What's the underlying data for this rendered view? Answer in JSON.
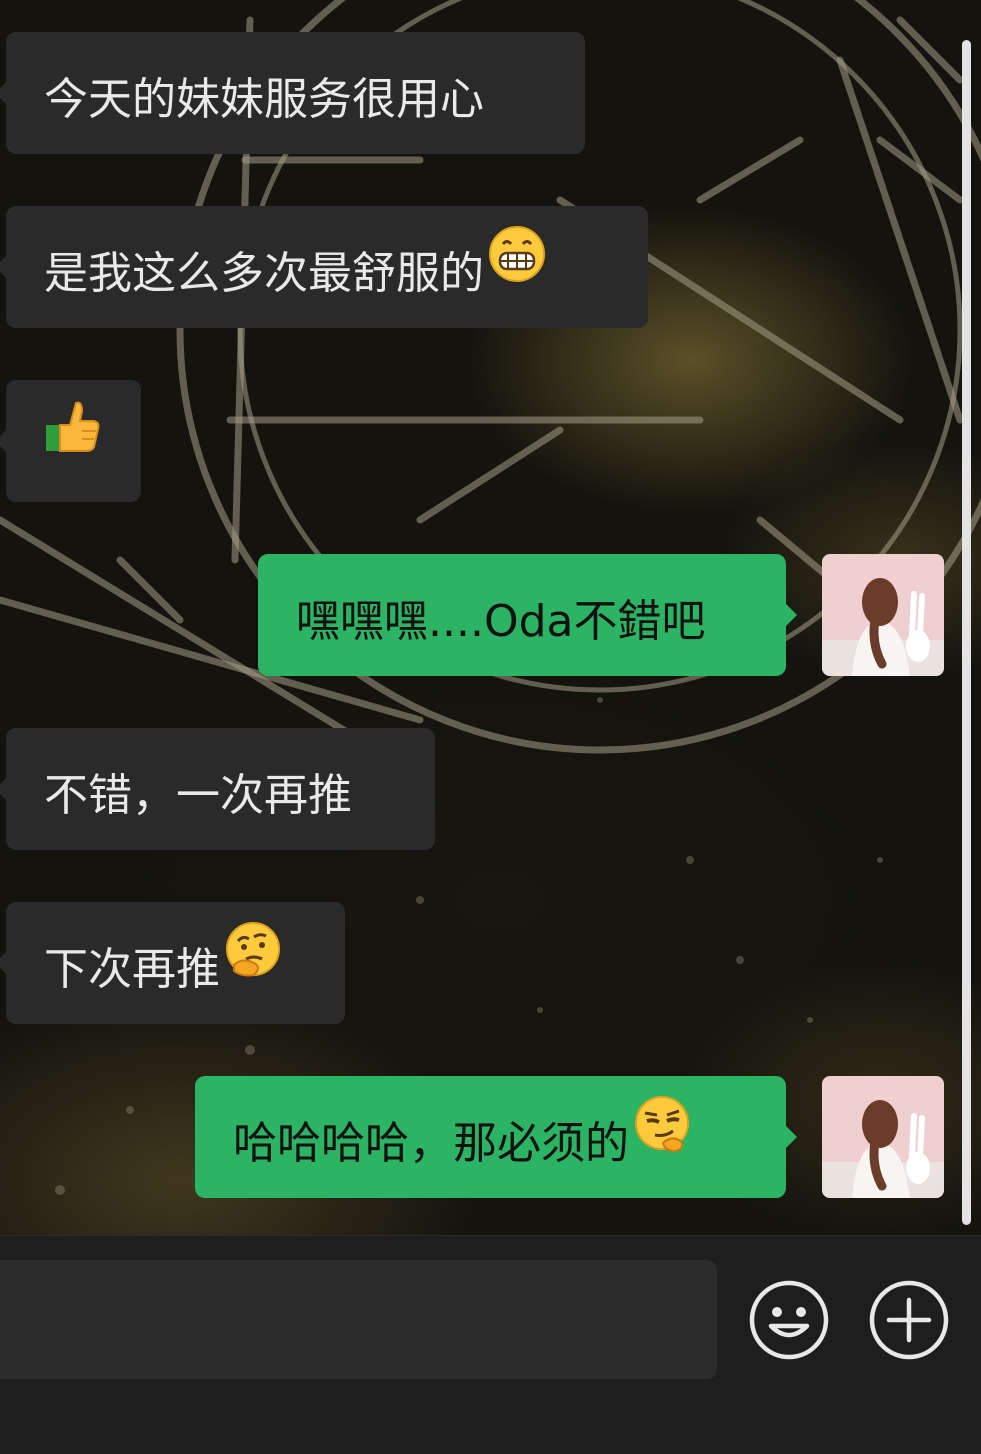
{
  "messages": [
    {
      "direction": "incoming",
      "text": "今天的妹妹服务很用心",
      "emoji": ""
    },
    {
      "direction": "incoming",
      "text": "是我这么多次最舒服的",
      "emoji": "grinning-face-icon"
    },
    {
      "direction": "incoming",
      "text": "",
      "emoji": "thumbs-up-icon"
    },
    {
      "direction": "outgoing",
      "text": "嘿嘿嘿....Oda不錯吧",
      "emoji": ""
    },
    {
      "direction": "incoming",
      "text": "不错，一次再推",
      "emoji": ""
    },
    {
      "direction": "incoming",
      "text": "下次再推",
      "emoji": "thinking-face-icon"
    },
    {
      "direction": "outgoing",
      "text": "哈哈哈哈，那必须的",
      "emoji": "smirking-face-icon"
    }
  ],
  "input": {
    "placeholder": ""
  },
  "controls": {
    "emoji_button": "smiley-icon",
    "add_button": "plus-icon"
  },
  "colors": {
    "incoming_bubble": "#2a2a2a",
    "outgoing_bubble": "#2bb463",
    "background": "#14130e"
  }
}
